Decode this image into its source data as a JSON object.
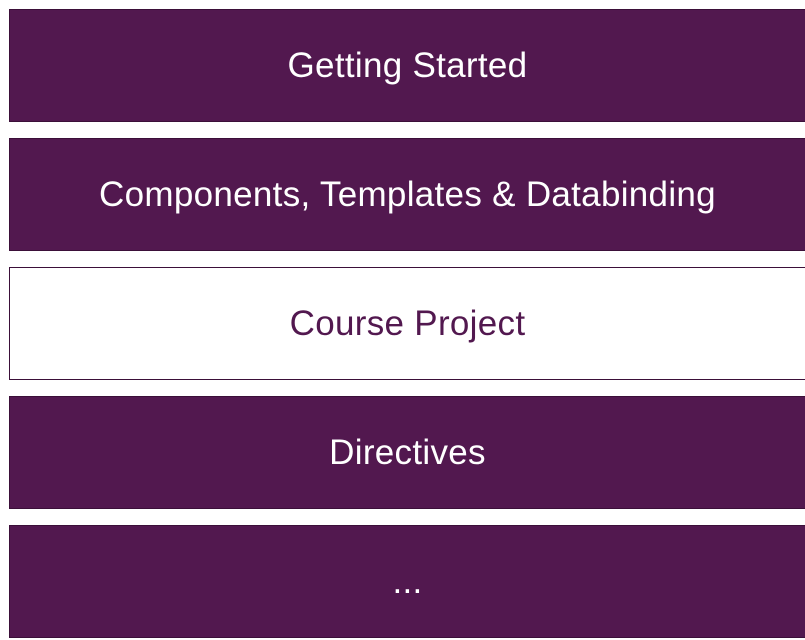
{
  "colors": {
    "primary": "#52184f",
    "primary_border": "#3b0f39",
    "text_on_primary": "#ffffff",
    "outline_text": "#52184f"
  },
  "blocks": [
    {
      "label": "Getting Started",
      "style": "filled"
    },
    {
      "label": "Components, Templates & Databinding",
      "style": "filled"
    },
    {
      "label": "Course Project",
      "style": "outlined"
    },
    {
      "label": "Directives",
      "style": "filled"
    },
    {
      "label": "...",
      "style": "filled"
    }
  ]
}
